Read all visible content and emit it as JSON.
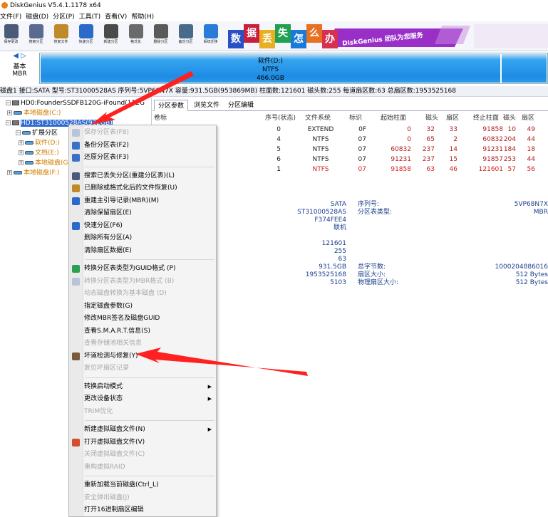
{
  "app": {
    "title": "DiskGenius V5.4.1.1178 x64"
  },
  "menu": [
    "文件(F)",
    "磁盘(D)",
    "分区(P)",
    "工具(T)",
    "查看(V)",
    "帮助(H)"
  ],
  "toolbar": [
    {
      "label": "保存更改",
      "icon": "save-icon",
      "color": "#4a5a78"
    },
    {
      "label": "搜索分区",
      "icon": "search-icon",
      "color": "#5a6a90"
    },
    {
      "label": "恢复文件",
      "icon": "recover-icon",
      "color": "#c08a2a"
    },
    {
      "label": "快速分区",
      "icon": "quick-partition-icon",
      "color": "#2a6ac8"
    },
    {
      "label": "新建分区",
      "icon": "new-partition-icon",
      "color": "#4a4a4a"
    },
    {
      "label": "格式化",
      "icon": "format-icon",
      "color": "#6a6a6a"
    },
    {
      "label": "删除分区",
      "icon": "delete-icon",
      "color": "#5a5a5a"
    },
    {
      "label": "备份分区",
      "icon": "backup-icon",
      "color": "#4a6a8a"
    },
    {
      "label": "系统迁移",
      "icon": "migrate-icon",
      "color": "#2a7ad8"
    }
  ],
  "banner": {
    "chars": [
      "数",
      "据",
      "丢",
      "失",
      "怎",
      "么",
      "办"
    ],
    "tagline": "DiskGenius 团队为您服务",
    "colors": [
      "#2a50c8",
      "#c8203c",
      "#e8b020",
      "#20a050",
      "#1a7ad8",
      "#e87020",
      "#d83050"
    ]
  },
  "disk_nav": {
    "type": "基本",
    "style": "MBR"
  },
  "disk_map": {
    "name": "软件(D:)",
    "fs": "NTFS",
    "size": "466.0GB"
  },
  "info_bar": "磁盘1 接口:SATA 型号:ST31000528AS 序列号:5VP68N7X 容量:931.5GB(953869MB) 柱面数:121601 磁头数:255 每道扇区数:63 总扇区数:1953525168",
  "tree": {
    "hd0": "HD0:FounderSSDFB120G-iFound(112G",
    "hd0_c": "本地磁盘(C:)",
    "hd1": "HD1:ST31000528AS(932GB)",
    "ext": "扩展分区",
    "d": "软件(D:)",
    "e": "文档(E:)",
    "g": "本地磁盘(G",
    "f": "本地磁盘(F:)"
  },
  "tabs": [
    "分区参数",
    "浏览文件",
    "分区编辑"
  ],
  "table": {
    "headers": [
      "卷标",
      "序号(状态)",
      "文件系统",
      "标识",
      "起始柱面",
      "磁头",
      "扇区",
      "终止柱面",
      "磁头",
      "扇区"
    ],
    "rows": [
      {
        "label": "",
        "seq": "0",
        "fs": "EXTEND",
        "id": "0F",
        "sc": "0",
        "sh": "32",
        "ss": "33",
        "ec": "91858",
        "eh": "10",
        "es": "49",
        "red": false
      },
      {
        "label": "",
        "seq": "4",
        "fs": "NTFS",
        "id": "07",
        "sc": "0",
        "sh": "65",
        "ss": "2",
        "ec": "60832",
        "eh": "204",
        "es": "44",
        "red": false
      },
      {
        "label": "",
        "seq": "5",
        "fs": "NTFS",
        "id": "07",
        "sc": "60832",
        "sh": "237",
        "ss": "14",
        "ec": "91231",
        "eh": "184",
        "es": "18",
        "red": false
      },
      {
        "label": "G:)",
        "seq": "6",
        "fs": "NTFS",
        "id": "07",
        "sc": "91231",
        "sh": "237",
        "ss": "15",
        "ec": "91857",
        "eh": "253",
        "es": "44",
        "red": false
      },
      {
        "label": "",
        "seq": "1",
        "fs": "NTFS",
        "id": "07",
        "sc": "91858",
        "sh": "63",
        "ss": "46",
        "ec": "121601",
        "eh": "57",
        "es": "56",
        "red": true
      }
    ]
  },
  "details": {
    "col1": [
      "SATA",
      "ST31000528AS",
      "F374FEE4",
      "联机",
      "",
      "121601",
      "255",
      "63",
      "931.5GB",
      "1953525168",
      "5103"
    ],
    "labels": [
      "序列号:",
      "分区表类型:",
      "",
      "",
      "",
      "",
      "",
      "",
      "总字节数:",
      "扇区大小:",
      "物理扇区大小:"
    ],
    "col2": [
      "5VP68N7X",
      "MBR",
      "",
      "",
      "",
      "",
      "",
      "",
      "1000204886016",
      "512 Bytes",
      "512 Bytes"
    ]
  },
  "context_menu": [
    {
      "label": "保存分区表(F8)",
      "disabled": true,
      "icon": "save-partition-table-icon"
    },
    {
      "label": "备份分区表(F2)",
      "disabled": false,
      "icon": "backup-partition-table-icon"
    },
    {
      "label": "还原分区表(F3)",
      "disabled": false,
      "icon": "restore-partition-table-icon"
    },
    {
      "sep": true
    },
    {
      "label": "搜索已丢失分区(重建分区表)(L)",
      "disabled": false,
      "icon": "search-icon"
    },
    {
      "label": "已删除或格式化后的文件恢复(U)",
      "disabled": false,
      "icon": "recover-icon"
    },
    {
      "label": "重建主引导记录(MBR)(M)",
      "disabled": false,
      "icon": "mbr-icon"
    },
    {
      "label": "清除保留扇区(E)",
      "disabled": false
    },
    {
      "label": "快速分区(F6)",
      "disabled": false,
      "icon": "quick-partition-icon"
    },
    {
      "label": "删除所有分区(A)",
      "disabled": false
    },
    {
      "label": "清除扇区数据(E)",
      "disabled": false
    },
    {
      "sep": true
    },
    {
      "label": "转换分区表类型为GUID格式 (P)",
      "disabled": false,
      "icon": "convert-icon"
    },
    {
      "label": "转换分区表类型为MBR格式 (B)",
      "disabled": true,
      "icon": "convert-mbr-icon"
    },
    {
      "label": "动态磁盘转换为基本磁盘 (D)",
      "disabled": true
    },
    {
      "label": "指定磁盘参数(G)",
      "disabled": false
    },
    {
      "label": "修改MBR签名及磁盘GUID",
      "disabled": false
    },
    {
      "label": "查看S.M.A.R.T.信息(S)",
      "disabled": false
    },
    {
      "label": "查看存储池相关信息",
      "disabled": true
    },
    {
      "label": "坏道检测与修复(Y)",
      "disabled": false,
      "icon": "tools-icon"
    },
    {
      "label": "复位坏扇区记录",
      "disabled": true
    },
    {
      "sep": true
    },
    {
      "label": "转换启动模式",
      "disabled": false,
      "submenu": true
    },
    {
      "label": "更改设备状态",
      "disabled": false,
      "submenu": true
    },
    {
      "label": "TRIM优化",
      "disabled": true
    },
    {
      "sep": true
    },
    {
      "label": "新建虚拟磁盘文件(N)",
      "disabled": false,
      "submenu": true
    },
    {
      "label": "打开虚拟磁盘文件(V)",
      "disabled": false,
      "icon": "open-virtual-disk-icon"
    },
    {
      "label": "关闭虚拟磁盘文件(C)",
      "disabled": true
    },
    {
      "label": "重构虚拟RAID",
      "disabled": true
    },
    {
      "sep": true
    },
    {
      "label": "重新加载当前磁盘(Ctrl_L)",
      "disabled": false
    },
    {
      "label": "安全弹出磁盘(J)",
      "disabled": true
    },
    {
      "label": "打开16进制扇区编辑",
      "disabled": false
    }
  ]
}
